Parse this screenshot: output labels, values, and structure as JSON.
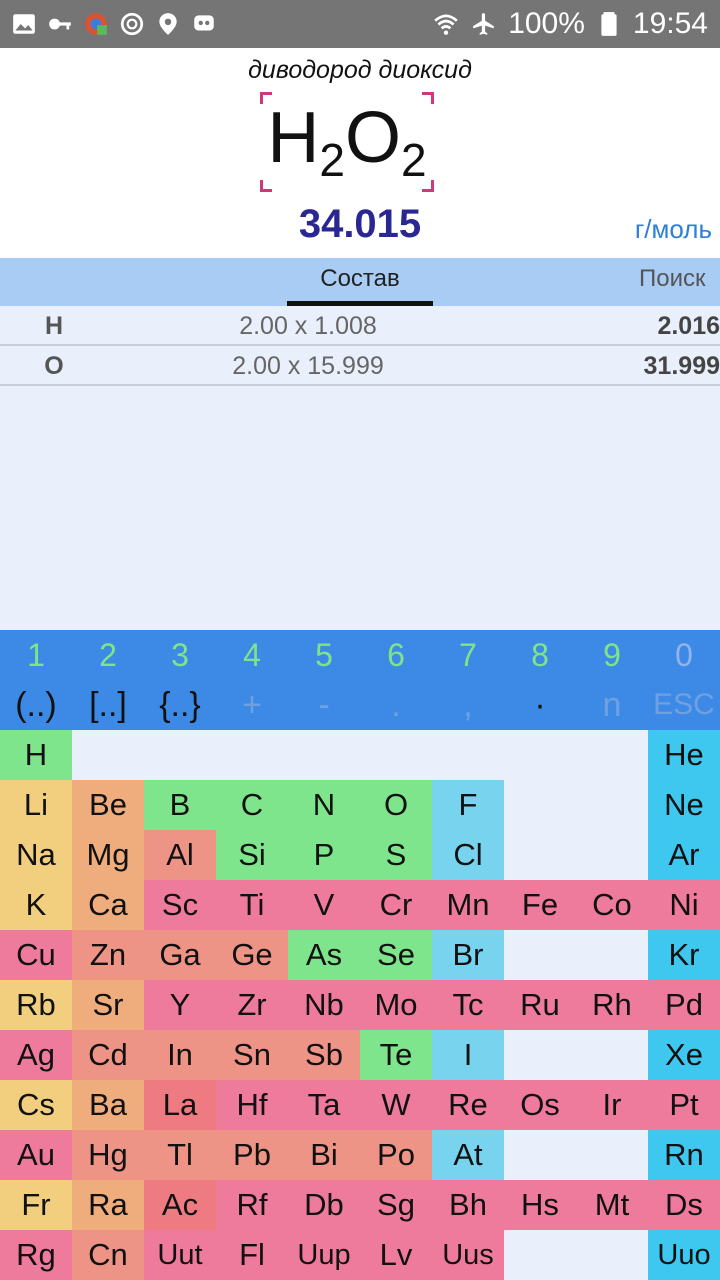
{
  "status_bar": {
    "battery": "100%",
    "time": "19:54",
    "icons": [
      "gallery-icon",
      "key-icon",
      "chrome-icon",
      "sync-icon",
      "location-icon",
      "chat-icon",
      "wifi-icon",
      "airplane-icon",
      "battery-icon"
    ]
  },
  "compound": {
    "name": "диводород диоксид",
    "formula_parts": [
      "H",
      "2",
      "O",
      "2"
    ],
    "molar_mass": "34.015",
    "units": "г/моль"
  },
  "tabs": {
    "composition": "Состав",
    "search": "Поиск"
  },
  "composition": [
    {
      "element": "H",
      "calc": "2.00 x 1.008",
      "total": "2.016"
    },
    {
      "element": "O",
      "calc": "2.00 x 15.999",
      "total": "31.999"
    }
  ],
  "keypad": {
    "numbers": [
      "1",
      "2",
      "3",
      "4",
      "5",
      "6",
      "7",
      "8",
      "9",
      "0"
    ],
    "symbols": [
      "(..)",
      "[..]",
      "{..}",
      "+",
      "-",
      ".",
      ",",
      "·",
      "n",
      "ESC"
    ]
  },
  "periodic_table": [
    [
      "H",
      "",
      "",
      "",
      "",
      "",
      "",
      "",
      "",
      "He"
    ],
    [
      "Li",
      "Be",
      "B",
      "C",
      "N",
      "O",
      "F",
      "",
      "",
      "Ne"
    ],
    [
      "Na",
      "Mg",
      "Al",
      "Si",
      "P",
      "S",
      "Cl",
      "",
      "",
      "Ar"
    ],
    [
      "K",
      "Ca",
      "Sc",
      "Ti",
      "V",
      "Cr",
      "Mn",
      "Fe",
      "Co",
      "Ni"
    ],
    [
      "Cu",
      "Zn",
      "Ga",
      "Ge",
      "As",
      "Se",
      "Br",
      "",
      "",
      "Kr"
    ],
    [
      "Rb",
      "Sr",
      "Y",
      "Zr",
      "Nb",
      "Mo",
      "Tc",
      "Ru",
      "Rh",
      "Pd"
    ],
    [
      "Ag",
      "Cd",
      "In",
      "Sn",
      "Sb",
      "Te",
      "I",
      "",
      "",
      "Xe"
    ],
    [
      "Cs",
      "Ba",
      "La",
      "Hf",
      "Ta",
      "W",
      "Re",
      "Os",
      "Ir",
      "Pt"
    ],
    [
      "Au",
      "Hg",
      "Tl",
      "Pb",
      "Bi",
      "Po",
      "At",
      "",
      "",
      "Rn"
    ],
    [
      "Fr",
      "Ra",
      "Ac",
      "Rf",
      "Db",
      "Sg",
      "Bh",
      "Hs",
      "Mt",
      "Ds"
    ],
    [
      "Rg",
      "Cn",
      "Uut",
      "Fl",
      "Uup",
      "Lv",
      "Uus",
      "",
      "",
      "Uuo"
    ]
  ],
  "colors": {
    "alkali": "#f2cf7f",
    "alkaline_earth": "#efad7e",
    "nonmetal": "#7fe58c",
    "halogen": "#78d3ef",
    "noble_gas": "#3ec7ef",
    "transition": "#ef7b9c",
    "post_transition": "#ee9486",
    "molar_mass": "#2a2794",
    "keypad_bg": "#3d8ae6",
    "tab_bar_bg": "#a9ccf5"
  }
}
